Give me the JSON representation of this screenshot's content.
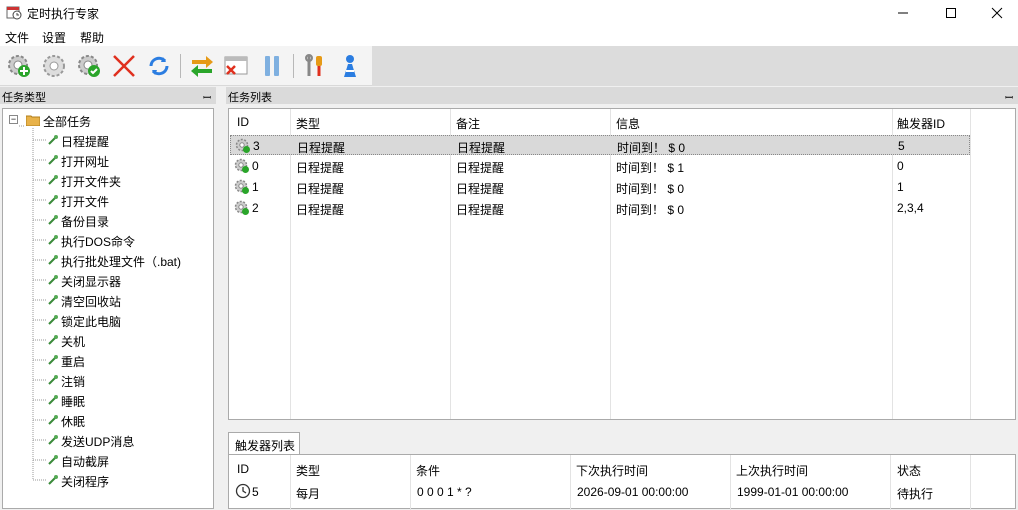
{
  "window": {
    "title": "定时执行专家",
    "icon": "calendar-clock-icon",
    "controls": [
      "minimize-icon",
      "maximize-icon",
      "close-icon"
    ]
  },
  "menu": {
    "file": "文件",
    "settings": "设置",
    "help": "帮助"
  },
  "toolbar": {
    "icons": [
      "add-task-icon",
      "settings-gear-icon",
      "enable-task-icon",
      "delete-icon",
      "refresh-icon",
      "switch-icon",
      "remove-window-icon",
      "pause-icon",
      "tools-icon",
      "user-icon"
    ]
  },
  "task_types_panel": {
    "title": "任务类型",
    "root": "全部任务",
    "items": [
      "日程提醒",
      "打开网址",
      "打开文件夹",
      "打开文件",
      "备份目录",
      "执行DOS命令",
      "执行批处理文件（.bat)",
      "关闭显示器",
      "清空回收站",
      "锁定此电脑",
      "关机",
      "重启",
      "注销",
      "睡眠",
      "休眠",
      "发送UDP消息",
      "自动截屏",
      "关闭程序"
    ]
  },
  "task_list_panel": {
    "title": "任务列表",
    "columns": [
      "ID",
      "类型",
      "备注",
      "信息",
      "触发器ID"
    ],
    "rows": [
      {
        "id": "3",
        "type": "日程提醒",
        "note": "日程提醒",
        "info": "时间到！ $ 0",
        "trigger_ids": "5",
        "selected": true
      },
      {
        "id": "0",
        "type": "日程提醒",
        "note": "日程提醒",
        "info": "时间到！ $ 1",
        "trigger_ids": "0",
        "selected": false
      },
      {
        "id": "1",
        "type": "日程提醒",
        "note": "日程提醒",
        "info": "时间到！ $ 0",
        "trigger_ids": "1",
        "selected": false
      },
      {
        "id": "2",
        "type": "日程提醒",
        "note": "日程提醒",
        "info": "时间到！ $ 0",
        "trigger_ids": "2,3,4",
        "selected": false
      }
    ]
  },
  "trigger_list_panel": {
    "tab": "触发器列表",
    "columns": [
      "ID",
      "类型",
      "条件",
      "下次执行时间",
      "上次执行时间",
      "状态"
    ],
    "rows": [
      {
        "id": "5",
        "type": "每月",
        "condition": "0 0 0 1 * ?",
        "next_run": "2026-09-01 00:00:00",
        "last_run": "1999-01-01 00:00:00",
        "status": "待执行"
      }
    ]
  },
  "colors": {
    "selected_row": "#d9d9d9",
    "window_bg": "#f0f0f0",
    "accent_red": "#e0301e",
    "accent_blue": "#2b7de1"
  }
}
